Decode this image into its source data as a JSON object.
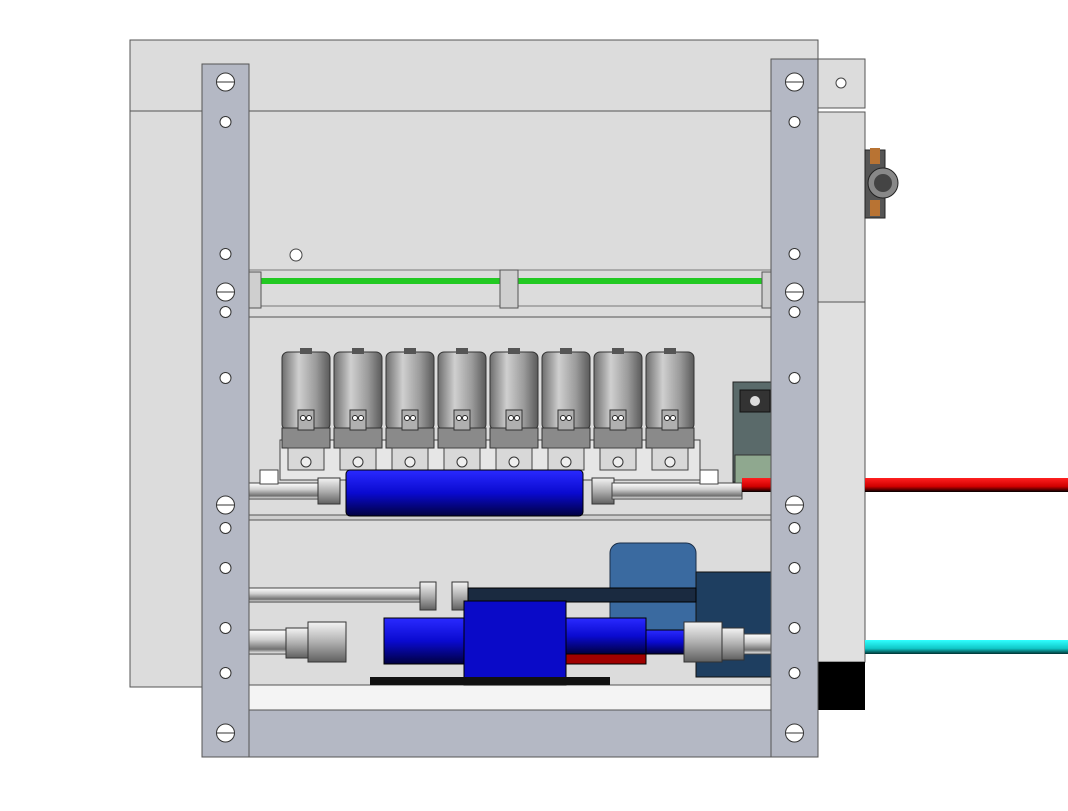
{
  "scene": {
    "description_label": "",
    "colors": {
      "background": "#ffffff",
      "panel": "#dcdcdc",
      "frame": "#b4b8c4",
      "outline": "#555555",
      "pcb_trace": "#22c922",
      "solenoid_body": "#9a9a9a",
      "block_blue": "#1414c8",
      "pipe_red": "#e00000",
      "pipe_cyan": "#10e0e0",
      "dark_blue": "#1e3e60"
    },
    "components": {
      "solenoid_valves": 8,
      "frame_rails": 2,
      "shelves": 3
    }
  }
}
